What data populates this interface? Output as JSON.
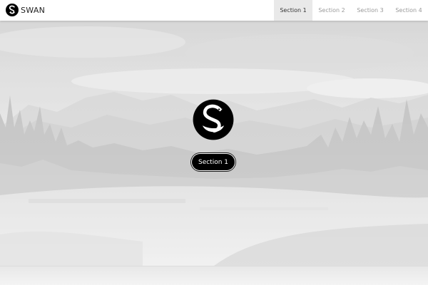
{
  "header": {
    "brand_name": "SWAN",
    "brand_logo_icon": "swan-logo-icon",
    "nav": [
      {
        "label": "Section 1",
        "active": true
      },
      {
        "label": "Section 2",
        "active": false
      },
      {
        "label": "Section 3",
        "active": false
      },
      {
        "label": "Section 4",
        "active": false
      }
    ]
  },
  "hero": {
    "logo_icon": "swan-logo-icon",
    "button_label": "Section 1",
    "background": "grayscale mountain lake landscape"
  },
  "colors": {
    "header_bg": "#ffffff",
    "active_nav_bg": "#e9e9e9",
    "button_bg": "#000000",
    "button_text": "#ffffff"
  }
}
